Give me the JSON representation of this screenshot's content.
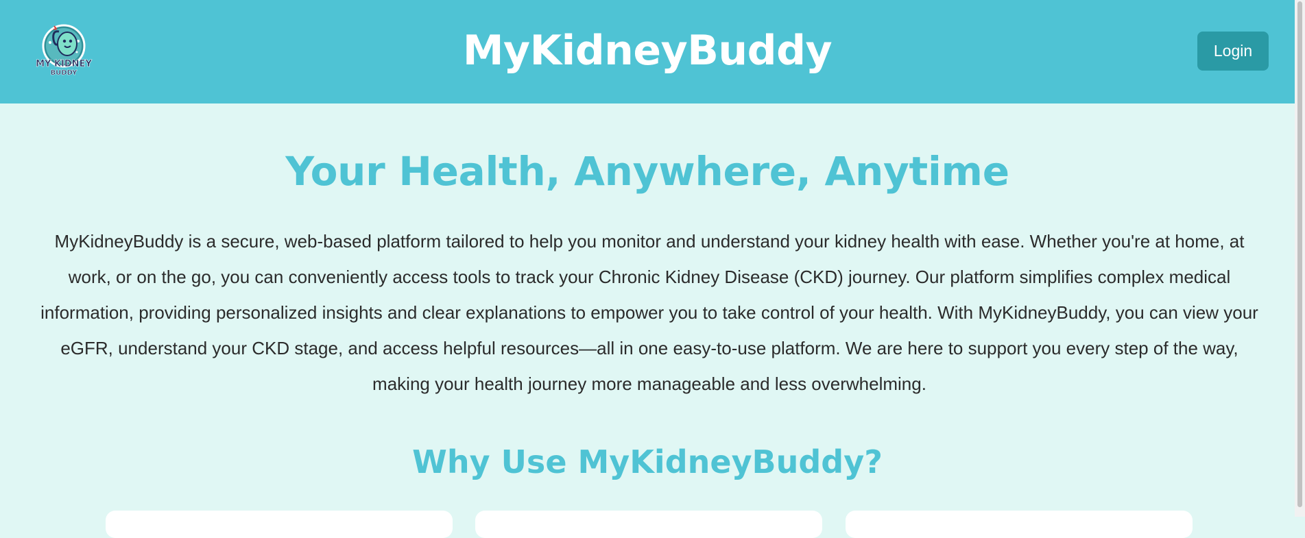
{
  "header": {
    "title": "MyKidneyBuddy",
    "login_label": "Login",
    "logo_text_top": "MY KIDNEY",
    "logo_text_bottom": "BUDDY",
    "logo_icon": "kidney-mascot-icon"
  },
  "hero": {
    "title": "Your Health, Anywhere, Anytime",
    "description": "MyKidneyBuddy is a secure, web-based platform tailored to help you monitor and understand your kidney health with ease. Whether you're at home, at work, or on the go, you can conveniently access tools to track your Chronic Kidney Disease (CKD) journey. Our platform simplifies complex medical information, providing personalized insights and clear explanations to empower you to take control of your health. With MyKidneyBuddy, you can view your eGFR, understand your CKD stage, and access helpful resources—all in one easy-to-use platform. We are here to support you every step of the way, making your health journey more manageable and less overwhelming."
  },
  "features": {
    "title": "Why Use MyKidneyBuddy?"
  },
  "colors": {
    "header_bg": "#4fc3d4",
    "page_bg": "#e0f7f4",
    "accent": "#4fc3d4",
    "button_bg": "#2a9aa5"
  }
}
